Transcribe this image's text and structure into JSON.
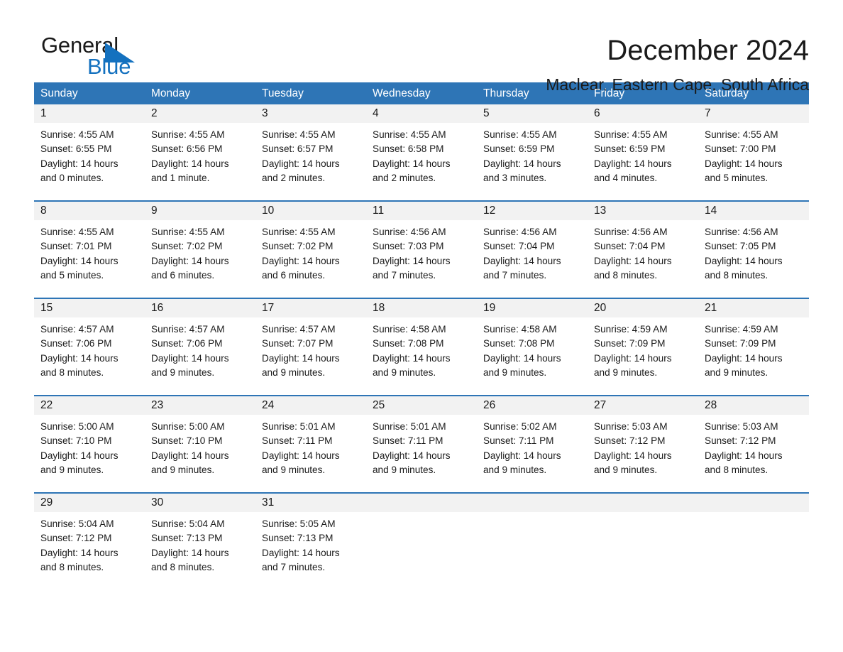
{
  "brand": {
    "name_part1": "General",
    "name_part2": "Blue",
    "flag_icon": "triangle-flag-icon",
    "accent_color": "#1471bf"
  },
  "header": {
    "month_title": "December 2024",
    "location": "Maclear, Eastern Cape, South Africa"
  },
  "theme": {
    "header_blue": "#2e75b6",
    "date_band_gray": "#f2f2f2",
    "text_color": "#1a1a1a"
  },
  "calendar": {
    "weekdays": [
      "Sunday",
      "Monday",
      "Tuesday",
      "Wednesday",
      "Thursday",
      "Friday",
      "Saturday"
    ],
    "weeks": [
      {
        "days": [
          {
            "date": "1",
            "lines": [
              "Sunrise: 4:55 AM",
              "Sunset: 6:55 PM",
              "Daylight: 14 hours",
              "and 0 minutes."
            ]
          },
          {
            "date": "2",
            "lines": [
              "Sunrise: 4:55 AM",
              "Sunset: 6:56 PM",
              "Daylight: 14 hours",
              "and 1 minute."
            ]
          },
          {
            "date": "3",
            "lines": [
              "Sunrise: 4:55 AM",
              "Sunset: 6:57 PM",
              "Daylight: 14 hours",
              "and 2 minutes."
            ]
          },
          {
            "date": "4",
            "lines": [
              "Sunrise: 4:55 AM",
              "Sunset: 6:58 PM",
              "Daylight: 14 hours",
              "and 2 minutes."
            ]
          },
          {
            "date": "5",
            "lines": [
              "Sunrise: 4:55 AM",
              "Sunset: 6:59 PM",
              "Daylight: 14 hours",
              "and 3 minutes."
            ]
          },
          {
            "date": "6",
            "lines": [
              "Sunrise: 4:55 AM",
              "Sunset: 6:59 PM",
              "Daylight: 14 hours",
              "and 4 minutes."
            ]
          },
          {
            "date": "7",
            "lines": [
              "Sunrise: 4:55 AM",
              "Sunset: 7:00 PM",
              "Daylight: 14 hours",
              "and 5 minutes."
            ]
          }
        ]
      },
      {
        "days": [
          {
            "date": "8",
            "lines": [
              "Sunrise: 4:55 AM",
              "Sunset: 7:01 PM",
              "Daylight: 14 hours",
              "and 5 minutes."
            ]
          },
          {
            "date": "9",
            "lines": [
              "Sunrise: 4:55 AM",
              "Sunset: 7:02 PM",
              "Daylight: 14 hours",
              "and 6 minutes."
            ]
          },
          {
            "date": "10",
            "lines": [
              "Sunrise: 4:55 AM",
              "Sunset: 7:02 PM",
              "Daylight: 14 hours",
              "and 6 minutes."
            ]
          },
          {
            "date": "11",
            "lines": [
              "Sunrise: 4:56 AM",
              "Sunset: 7:03 PM",
              "Daylight: 14 hours",
              "and 7 minutes."
            ]
          },
          {
            "date": "12",
            "lines": [
              "Sunrise: 4:56 AM",
              "Sunset: 7:04 PM",
              "Daylight: 14 hours",
              "and 7 minutes."
            ]
          },
          {
            "date": "13",
            "lines": [
              "Sunrise: 4:56 AM",
              "Sunset: 7:04 PM",
              "Daylight: 14 hours",
              "and 8 minutes."
            ]
          },
          {
            "date": "14",
            "lines": [
              "Sunrise: 4:56 AM",
              "Sunset: 7:05 PM",
              "Daylight: 14 hours",
              "and 8 minutes."
            ]
          }
        ]
      },
      {
        "days": [
          {
            "date": "15",
            "lines": [
              "Sunrise: 4:57 AM",
              "Sunset: 7:06 PM",
              "Daylight: 14 hours",
              "and 8 minutes."
            ]
          },
          {
            "date": "16",
            "lines": [
              "Sunrise: 4:57 AM",
              "Sunset: 7:06 PM",
              "Daylight: 14 hours",
              "and 9 minutes."
            ]
          },
          {
            "date": "17",
            "lines": [
              "Sunrise: 4:57 AM",
              "Sunset: 7:07 PM",
              "Daylight: 14 hours",
              "and 9 minutes."
            ]
          },
          {
            "date": "18",
            "lines": [
              "Sunrise: 4:58 AM",
              "Sunset: 7:08 PM",
              "Daylight: 14 hours",
              "and 9 minutes."
            ]
          },
          {
            "date": "19",
            "lines": [
              "Sunrise: 4:58 AM",
              "Sunset: 7:08 PM",
              "Daylight: 14 hours",
              "and 9 minutes."
            ]
          },
          {
            "date": "20",
            "lines": [
              "Sunrise: 4:59 AM",
              "Sunset: 7:09 PM",
              "Daylight: 14 hours",
              "and 9 minutes."
            ]
          },
          {
            "date": "21",
            "lines": [
              "Sunrise: 4:59 AM",
              "Sunset: 7:09 PM",
              "Daylight: 14 hours",
              "and 9 minutes."
            ]
          }
        ]
      },
      {
        "days": [
          {
            "date": "22",
            "lines": [
              "Sunrise: 5:00 AM",
              "Sunset: 7:10 PM",
              "Daylight: 14 hours",
              "and 9 minutes."
            ]
          },
          {
            "date": "23",
            "lines": [
              "Sunrise: 5:00 AM",
              "Sunset: 7:10 PM",
              "Daylight: 14 hours",
              "and 9 minutes."
            ]
          },
          {
            "date": "24",
            "lines": [
              "Sunrise: 5:01 AM",
              "Sunset: 7:11 PM",
              "Daylight: 14 hours",
              "and 9 minutes."
            ]
          },
          {
            "date": "25",
            "lines": [
              "Sunrise: 5:01 AM",
              "Sunset: 7:11 PM",
              "Daylight: 14 hours",
              "and 9 minutes."
            ]
          },
          {
            "date": "26",
            "lines": [
              "Sunrise: 5:02 AM",
              "Sunset: 7:11 PM",
              "Daylight: 14 hours",
              "and 9 minutes."
            ]
          },
          {
            "date": "27",
            "lines": [
              "Sunrise: 5:03 AM",
              "Sunset: 7:12 PM",
              "Daylight: 14 hours",
              "and 9 minutes."
            ]
          },
          {
            "date": "28",
            "lines": [
              "Sunrise: 5:03 AM",
              "Sunset: 7:12 PM",
              "Daylight: 14 hours",
              "and 8 minutes."
            ]
          }
        ]
      },
      {
        "days": [
          {
            "date": "29",
            "lines": [
              "Sunrise: 5:04 AM",
              "Sunset: 7:12 PM",
              "Daylight: 14 hours",
              "and 8 minutes."
            ]
          },
          {
            "date": "30",
            "lines": [
              "Sunrise: 5:04 AM",
              "Sunset: 7:13 PM",
              "Daylight: 14 hours",
              "and 8 minutes."
            ]
          },
          {
            "date": "31",
            "lines": [
              "Sunrise: 5:05 AM",
              "Sunset: 7:13 PM",
              "Daylight: 14 hours",
              "and 7 minutes."
            ]
          },
          {
            "date": "",
            "lines": []
          },
          {
            "date": "",
            "lines": []
          },
          {
            "date": "",
            "lines": []
          },
          {
            "date": "",
            "lines": []
          }
        ]
      }
    ]
  }
}
